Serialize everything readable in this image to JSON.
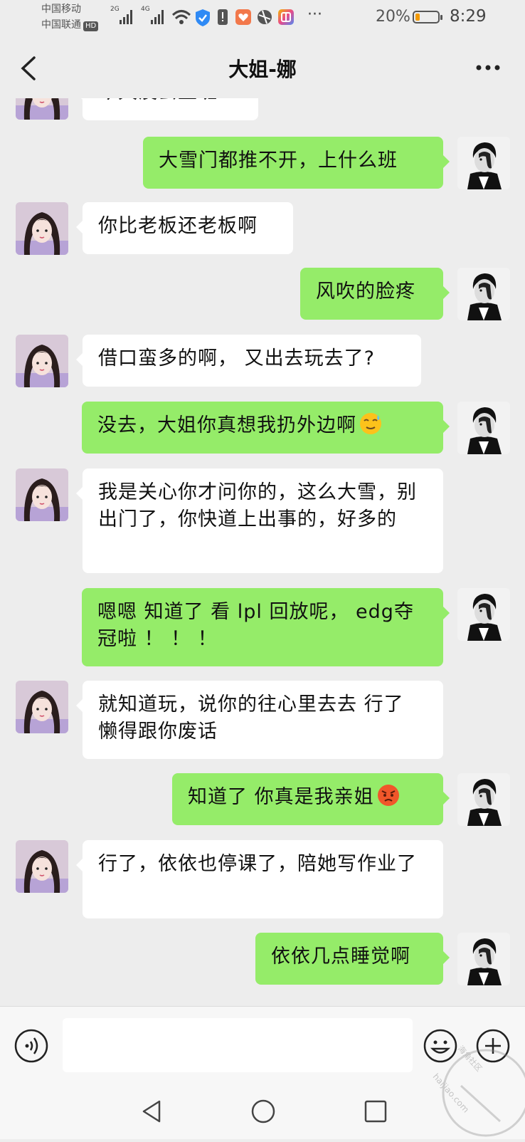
{
  "status": {
    "carrier1": "中国移动",
    "carrier2": "中国联通",
    "carrier2_badge": "HD",
    "net1": "2G",
    "net2": "4G",
    "more": "···",
    "battery_pct": "20%",
    "battery_level": 0.2,
    "time": "8:29"
  },
  "header": {
    "title": "大姐-娜",
    "back_icon": "chevron-left-icon",
    "more_icon": "more-dots-icon"
  },
  "messages": [
    {
      "from": "her",
      "text": "今天没去上班?"
    },
    {
      "from": "me",
      "text": "大雪门都推不开，上什么班"
    },
    {
      "from": "her",
      "text": "你比老板还老板啊"
    },
    {
      "from": "me",
      "text": "风吹的脸疼"
    },
    {
      "from": "her",
      "text": "借口蛮多的啊， 又出去玩去了?"
    },
    {
      "from": "me",
      "text": "没去，大姐你真想我扔外边啊",
      "emoji": "sweat-smile-emoji"
    },
    {
      "from": "her",
      "text": "我是关心你才问你的，这么大雪，别出门了，你快道上出事的，好多的"
    },
    {
      "from": "me",
      "text": "嗯嗯 知道了  看 lpl 回放呢， edg夺冠啦 ！ ！ ！"
    },
    {
      "from": "her",
      "text": "就知道玩，说你的往心里去去 行了 懒得跟你废话"
    },
    {
      "from": "me",
      "text": "知道了  你真是我亲姐",
      "emoji": "angry-face-emoji"
    },
    {
      "from": "her",
      "text": "行了，依依也停课了，陪她写作业了"
    },
    {
      "from": "me",
      "text": "依依几点睡觉啊"
    }
  ],
  "input": {
    "placeholder": "",
    "voice_icon": "voice-icon",
    "emoji_icon": "emoji-icon",
    "plus_icon": "plus-icon"
  },
  "nav": {
    "back": "nav-back-icon",
    "home": "nav-home-icon",
    "recent": "nav-recent-icon"
  },
  "watermark": {
    "line1": "海角社区",
    "line2": "haijiao.com"
  },
  "colors": {
    "bg": "#ededed",
    "bubble_out": "#95ec69",
    "bubble_in": "#ffffff",
    "battery": "#f29900"
  }
}
